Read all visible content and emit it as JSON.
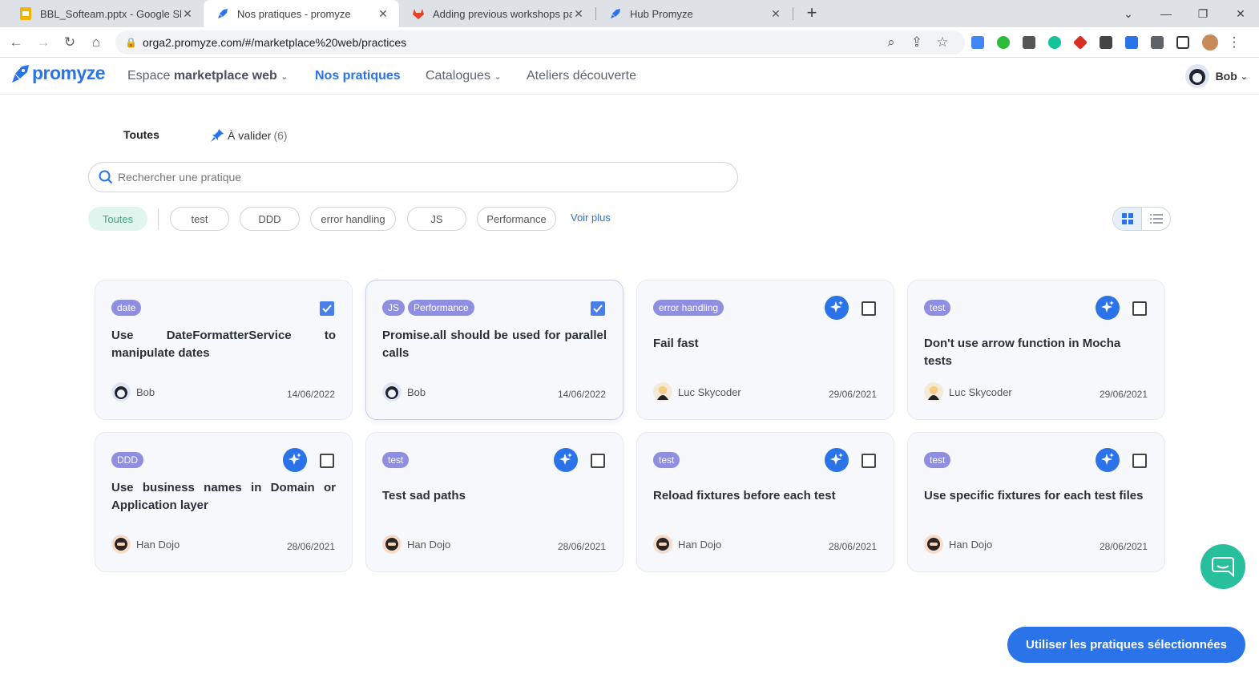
{
  "browser": {
    "tabs": [
      {
        "title": "BBL_Softeam.pptx - Google Slide",
        "favicon": "google-slides-icon"
      },
      {
        "title": "Nos pratiques - promyze",
        "favicon": "promyze-rocket-icon"
      },
      {
        "title": "Adding previous workshops pag",
        "favicon": "gitlab-icon"
      },
      {
        "title": "Hub Promyze",
        "favicon": "promyze-rocket-icon"
      }
    ],
    "url": "orga2.promyze.com/#/marketplace%20web/practices"
  },
  "header": {
    "logo_text": "promyze",
    "space_label": "Espace",
    "space_name": "marketplace web",
    "nav": [
      "Nos pratiques",
      "Catalogues",
      "Ateliers découverte"
    ],
    "user_name": "Bob"
  },
  "filters": {
    "tab_all": "Toutes",
    "tab_validate": "À valider",
    "tab_validate_count": "(6)",
    "search_placeholder": "Rechercher une pratique",
    "chips": [
      "Toutes",
      "test",
      "DDD",
      "error handling",
      "JS",
      "Performance"
    ],
    "more": "Voir plus"
  },
  "cards": [
    {
      "tags": [
        "date"
      ],
      "title": "Use DateFormatterService to manipulate dates",
      "author": "Bob",
      "date": "14/06/2022",
      "checked": true,
      "spark": false
    },
    {
      "tags": [
        "JS",
        "Performance"
      ],
      "title": "Promise.all should be used for parallel calls",
      "author": "Bob",
      "date": "14/06/2022",
      "checked": true,
      "spark": false
    },
    {
      "tags": [
        "error handling"
      ],
      "title": "Fail fast",
      "author": "Luc Skycoder",
      "date": "29/06/2021",
      "checked": false,
      "spark": true
    },
    {
      "tags": [
        "test"
      ],
      "title": "Don't use arrow function in Mocha tests",
      "author": "Luc Skycoder",
      "date": "29/06/2021",
      "checked": false,
      "spark": true
    },
    {
      "tags": [
        "DDD"
      ],
      "title": "Use business names in Domain or Application layer",
      "author": "Han Dojo",
      "date": "28/06/2021",
      "checked": false,
      "spark": true
    },
    {
      "tags": [
        "test"
      ],
      "title": "Test sad paths",
      "author": "Han Dojo",
      "date": "28/06/2021",
      "checked": false,
      "spark": true
    },
    {
      "tags": [
        "test"
      ],
      "title": "Reload fixtures before each test",
      "author": "Han Dojo",
      "date": "28/06/2021",
      "checked": false,
      "spark": true
    },
    {
      "tags": [
        "test"
      ],
      "title": "Use specific fixtures for each test files",
      "author": "Han Dojo",
      "date": "28/06/2021",
      "checked": false,
      "spark": true
    }
  ],
  "cta_label": "Utiliser les pratiques sélectionnées",
  "colors": {
    "accent": "#2a73e8",
    "tag": "#8f8ee0",
    "chip_selected_bg": "#dff5ee",
    "chat": "#28bf9d"
  }
}
